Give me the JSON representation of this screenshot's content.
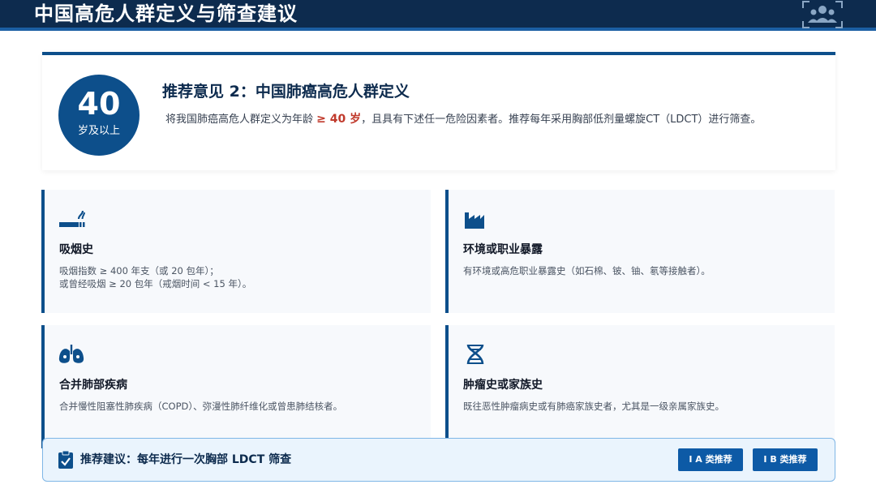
{
  "header": {
    "title": "中国高危人群定义与筛查建议",
    "logo_icon": "people-group-icon"
  },
  "recommendation": {
    "age_number": "40",
    "age_label": "岁及以上",
    "title": "推荐意见 2：中国肺癌高危人群定义",
    "desc_prefix": "将我国肺癌高危人群定义为年龄",
    "desc_highlight": "≥ 40 岁",
    "desc_suffix": "，且具有下述任一危险因素者。推荐每年采用胸部低剂量螺旋CT（LDCT）进行筛查。",
    "highlight_color": "#c0392b"
  },
  "cards": [
    {
      "icon": "smoking-icon",
      "title": "吸烟史",
      "lines": [
        "吸烟指数 ≥ 400 年支（或 20 包年）；",
        "或曾经吸烟 ≥ 20 包年（戒烟时间 < 15 年）。"
      ]
    },
    {
      "icon": "factory-icon",
      "title": "环境或职业暴露",
      "lines": [
        "有环境或高危职业暴露史（如石棉、铍、铀、氡等接触者）。"
      ]
    },
    {
      "icon": "lungs-icon",
      "title": "合并肺部疾病",
      "lines": [
        "合并慢性阻塞性肺疾病（COPD）、弥漫性肺纤维化或曾患肺结核者。"
      ]
    },
    {
      "icon": "dna-icon",
      "title": "肿瘤史或家族史",
      "lines": [
        "既往恶性肿瘤病史或有肺癌家族史者，尤其是一级亲属家族史。"
      ]
    }
  ],
  "banner": {
    "icon": "clipboard-check-icon",
    "text": "推荐建议：每年进行一次胸部 LDCT 筛查",
    "badge_1": "I A 类推荐",
    "badge_2": "I B 类推荐"
  },
  "colors": {
    "primary": "#0d4f8b",
    "header_bg": "#0d2b4e",
    "accent_line": "#1b5fa3",
    "banner_bg": "#eaf4fd"
  }
}
